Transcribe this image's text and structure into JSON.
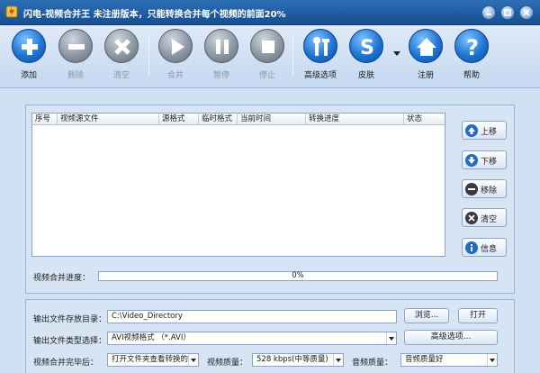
{
  "window": {
    "title": "闪电-视频合并王  未注册版本，只能转换合并每个视频的前面20%"
  },
  "toolbar": {
    "add": "添加",
    "delete": "删除",
    "clear": "清空",
    "merge": "合并",
    "pause": "暂停",
    "stop": "停止",
    "advanced": "高级选项",
    "skin": "皮肤",
    "register": "注册",
    "help": "帮助"
  },
  "list": {
    "columns": [
      "序号",
      "视频源文件",
      "源格式",
      "临时格式",
      "当前时间",
      "转换进度",
      "状态"
    ]
  },
  "side_buttons": {
    "up": "上移",
    "down": "下移",
    "remove": "移除",
    "clear": "清空",
    "info": "信息"
  },
  "progress": {
    "label": "视频合并进度：",
    "value_text": "0%",
    "value": 0
  },
  "settings": {
    "output_dir_label": "输出文件存放目录：",
    "output_dir_value": "C:\\Video_Directory",
    "browse": "浏览...",
    "open": "打开",
    "type_label": "输出文件类型选择：",
    "type_value": "AVI视频格式 （*.AVI）",
    "advanced": "高级选项...",
    "after_label": "视频合并完毕后：",
    "after_value": "打开文件夹查看转换的",
    "video_quality_label": "视频质量：",
    "video_quality_value": "528 kbps(中等质量)",
    "audio_quality_label": "音频质量：",
    "audio_quality_value": "音频质量好"
  }
}
